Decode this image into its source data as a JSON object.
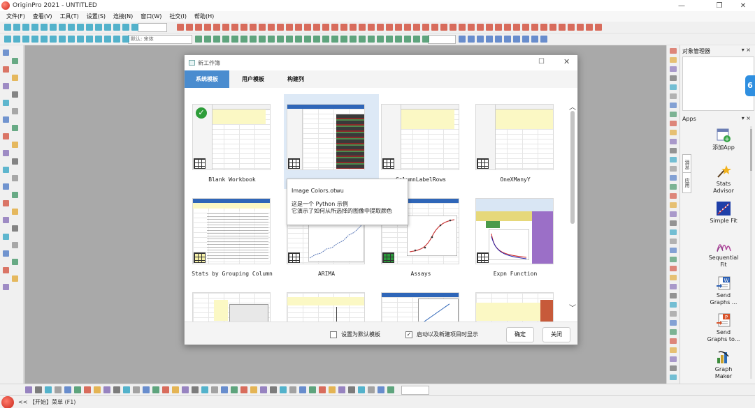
{
  "window": {
    "title": "OriginPro 2021 - UNTITLED"
  },
  "menu": [
    "文件(F)",
    "查看(V)",
    "工具(T)",
    "设置(S)",
    "连接(N)",
    "窗口(W)",
    "社交(I)",
    "帮助(H)"
  ],
  "toolbar": {
    "font_select": "默认: 宋体"
  },
  "panels": {
    "object_manager": {
      "title": "对象管理器",
      "controls": "▾ ×"
    },
    "apps": {
      "title": "Apps",
      "controls": "▾ ×"
    },
    "apps_tab_1": "消息",
    "apps_tab_2": "应用",
    "badge": "6"
  },
  "apps": [
    {
      "label1": "添加App",
      "label2": "",
      "icon": "add-app-icon"
    },
    {
      "label1": "Stats",
      "label2": "Advisor",
      "icon": "stats-advisor-icon"
    },
    {
      "label1": "Simple Fit",
      "label2": "",
      "icon": "simple-fit-icon"
    },
    {
      "label1": "Sequential",
      "label2": "Fit",
      "icon": "sequential-fit-icon"
    },
    {
      "label1": "Send",
      "label2": "Graphs ...",
      "icon": "send-graphs-word-icon"
    },
    {
      "label1": "Send",
      "label2": "Graphs to...",
      "icon": "send-graphs-ppt-icon"
    },
    {
      "label1": "Graph",
      "label2": "Maker",
      "icon": "graph-maker-icon"
    }
  ],
  "status": {
    "text": "<< 【开始】菜单 (F1)"
  },
  "dialog": {
    "title": "新工作簿",
    "tabs": [
      "系统模板",
      "用户模板",
      "构建列"
    ],
    "active_tab": 0,
    "templates": [
      {
        "name": "Blank Workbook"
      },
      {
        "name": ""
      },
      {
        "name": "ColumnLabelRows"
      },
      {
        "name": "OneXManyY"
      },
      {
        "name": "Stats by Grouping Column"
      },
      {
        "name": "ARIMA"
      },
      {
        "name": "Assays"
      },
      {
        "name": "Expn Function"
      }
    ],
    "tooltip": {
      "title": "Image Colors.otwu",
      "line1": "这是一个 Python 示例",
      "line2": "它演示了如何从所选择的图像中提取颜色"
    },
    "footer": {
      "default_template": "设置为默认模板",
      "show_on_startup": "启动以及新建项目时显示",
      "ok": "确定",
      "close": "关闭"
    },
    "checkboxes": {
      "default_template_checked": false,
      "show_on_startup_checked": true
    }
  },
  "colors": {
    "accent": "#4a8ccf",
    "workspace": "#a9a9a9",
    "badge_blue": "#2f8fe0"
  }
}
